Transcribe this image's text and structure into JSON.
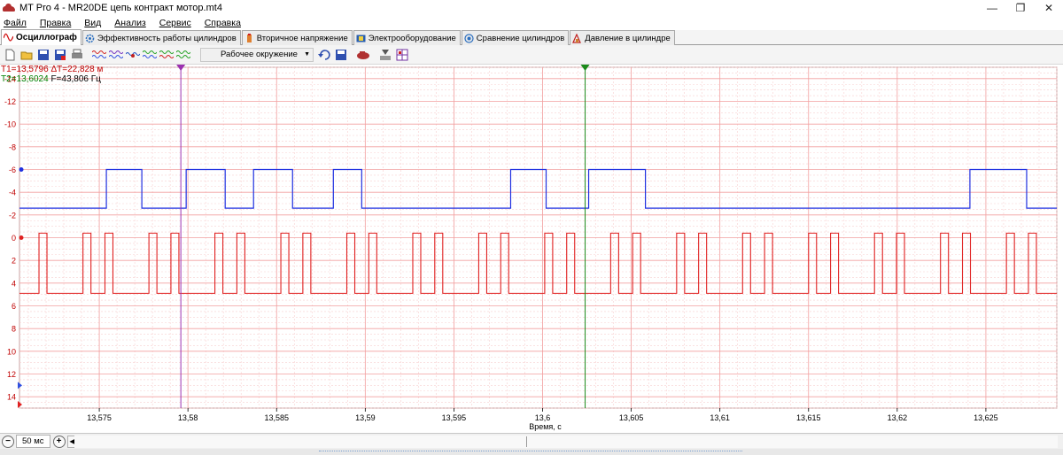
{
  "window": {
    "title": "MT Pro 4 - MR20DE  цепь контракт мотор.mt4",
    "minimize": "—",
    "restore": "❐",
    "close": "✕"
  },
  "menu": [
    "Файл",
    "Правка",
    "Вид",
    "Анализ",
    "Сервис",
    "Справка"
  ],
  "tabs": [
    {
      "label": "Осциллограф",
      "active": true,
      "icon": "sine-wave-icon"
    },
    {
      "label": "Эффективность работы цилиндров",
      "active": false,
      "icon": "gear-icon"
    },
    {
      "label": "Вторичное напряжение",
      "active": false,
      "icon": "coil-icon"
    },
    {
      "label": "Электрооборудование",
      "active": false,
      "icon": "battery-icon"
    },
    {
      "label": "Сравнение цилиндров",
      "active": false,
      "icon": "compare-icon"
    },
    {
      "label": "Давление в цилиндре",
      "active": false,
      "icon": "pressure-icon"
    }
  ],
  "toolbar": {
    "environment_combo": "Рабочее окружение"
  },
  "cursor_readout": {
    "t1": "T1=13,5796",
    "dt": "ΔT=22,828 м",
    "t2": "T2=13,6024",
    "freq": "F=43,806 Гц"
  },
  "chart_data": {
    "type": "line",
    "xlabel": "Время, с",
    "xlim": [
      13.5705,
      13.629
    ],
    "ylim": [
      -15,
      15
    ],
    "y_inverted": true,
    "x_ticks": [
      13.575,
      13.58,
      13.585,
      13.59,
      13.595,
      13.6,
      13.605,
      13.61,
      13.615,
      13.62,
      13.625
    ],
    "x_tick_labels": [
      "13,575",
      "13,58",
      "13,585",
      "13,59",
      "13,595",
      "13,6",
      "13,605",
      "13,61",
      "13,615",
      "13,62",
      "13,625"
    ],
    "y_ticks": [
      -14,
      -12,
      -10,
      -8,
      -6,
      -4,
      -2,
      0,
      2,
      4,
      6,
      8,
      10,
      12,
      14
    ],
    "y_tick_labels": [
      "-14",
      "-12",
      "-10",
      "-8",
      "-6",
      "-4",
      "-2",
      "0",
      "2",
      "4",
      "6",
      "8",
      "10",
      "12",
      "14"
    ],
    "grid": true,
    "cursors": [
      {
        "name": "T1",
        "x": 13.5796,
        "color": "#9b30b0"
      },
      {
        "name": "T2",
        "x": 13.6024,
        "color": "#1a8a1a"
      }
    ],
    "series": [
      {
        "color": "#2030e0",
        "low": -2.6,
        "high": -6.0,
        "high_intervals": [
          [
            13.5754,
            13.5774
          ],
          [
            13.5799,
            13.5821
          ],
          [
            13.5837,
            13.5859
          ],
          [
            13.5882,
            13.5898
          ],
          [
            13.5982,
            13.6002
          ],
          [
            13.6026,
            13.6058
          ],
          [
            13.6241,
            13.6273
          ]
        ]
      },
      {
        "color": "#e02020",
        "low": 4.9,
        "high": -0.4,
        "pulse_width": 0.00045,
        "pulse_period": 0.00124,
        "first_pulse": 13.5716,
        "skip_pulses": [
          13.5728,
          13.5765,
          13.5802,
          13.5839,
          13.5877,
          13.5914,
          13.5951,
          13.5988,
          13.6025,
          13.6062,
          13.6099,
          13.6137,
          13.6174,
          13.6211,
          13.6248,
          13.6285
        ]
      }
    ]
  },
  "statusbar": {
    "timebase": "50 мс",
    "zoom_out": "−",
    "zoom_in": "+",
    "scroll_left": "◀"
  },
  "colors": {
    "grid_major": "#f2a0a0",
    "grid_minor": "#f8d0d0",
    "axis_text": "#c00000",
    "cursor_t1": "#9b30b0",
    "cursor_t2": "#1a8a1a"
  }
}
